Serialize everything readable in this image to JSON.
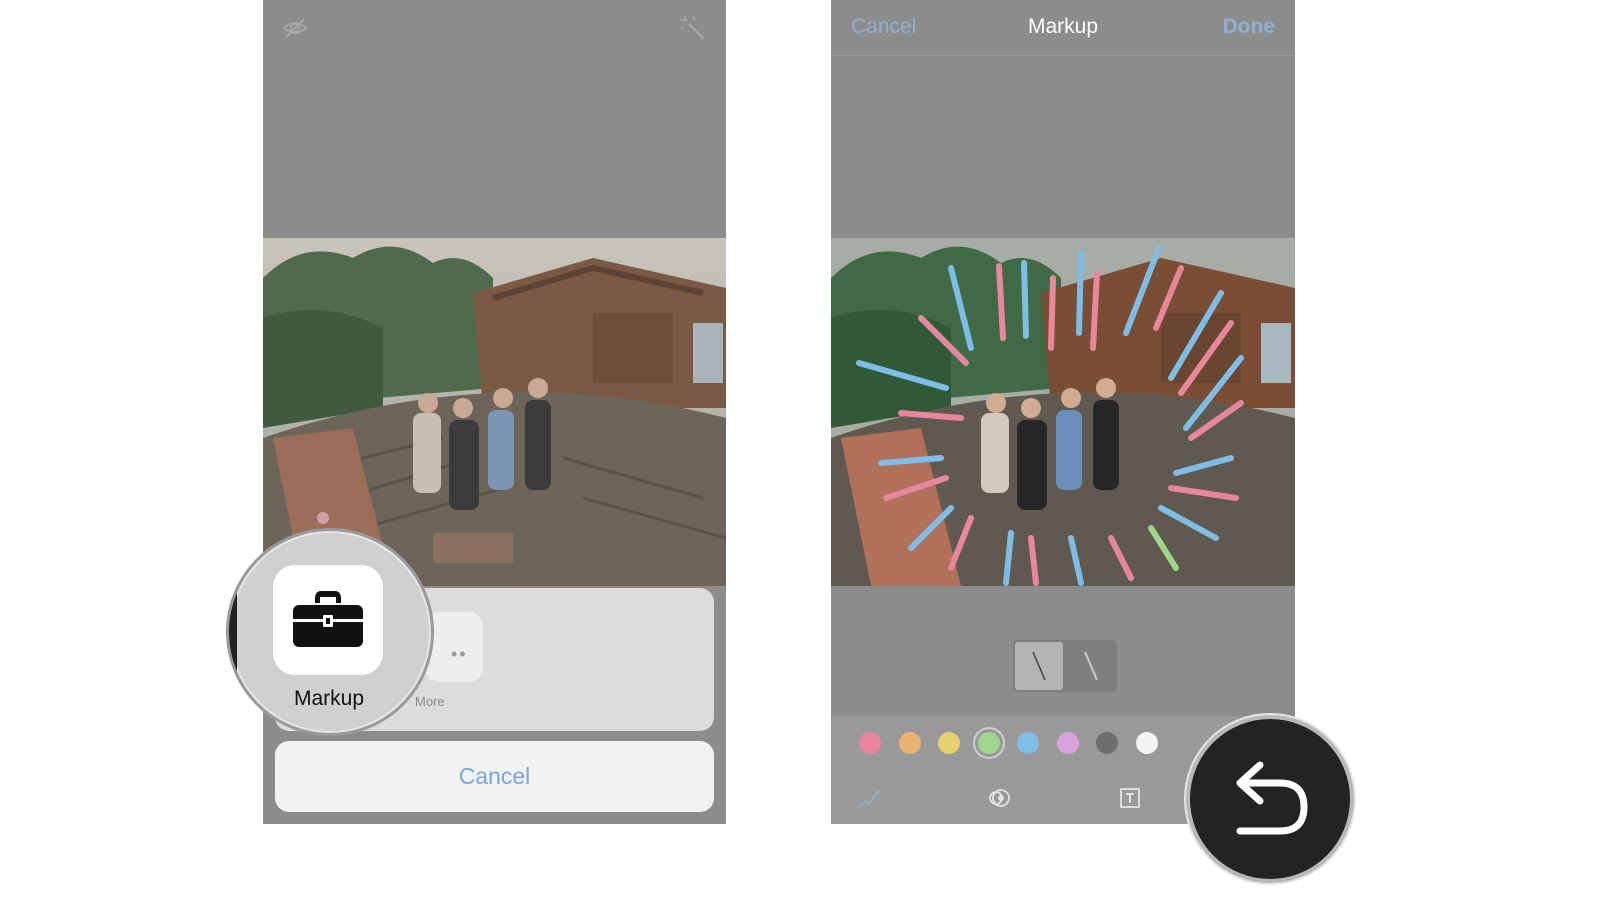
{
  "left_screen": {
    "share_sheet": {
      "markup_label": "Markup",
      "more_label": "More",
      "cancel_label": "Cancel"
    },
    "icons": [
      "hide-eye-icon",
      "magic-wand-icon",
      "toolbox-icon",
      "more-dots-icon"
    ]
  },
  "right_screen": {
    "navbar": {
      "cancel_label": "Cancel",
      "title": "Markup",
      "done_label": "Done"
    },
    "colors": [
      {
        "name": "pink",
        "hex": "#e8869c"
      },
      {
        "name": "orange",
        "hex": "#e9b46f"
      },
      {
        "name": "yellow",
        "hex": "#e6d16f"
      },
      {
        "name": "green",
        "hex": "#9ed68c",
        "selected": true
      },
      {
        "name": "blue",
        "hex": "#7fbde6"
      },
      {
        "name": "purple",
        "hex": "#d6a3dc"
      },
      {
        "name": "gray",
        "hex": "#6e6e6e"
      },
      {
        "name": "white",
        "hex": "#f4f4f4"
      }
    ],
    "tools": [
      "pen-tool-icon",
      "magnifier-tool-icon",
      "text-tool-icon",
      "undo-icon"
    ]
  }
}
